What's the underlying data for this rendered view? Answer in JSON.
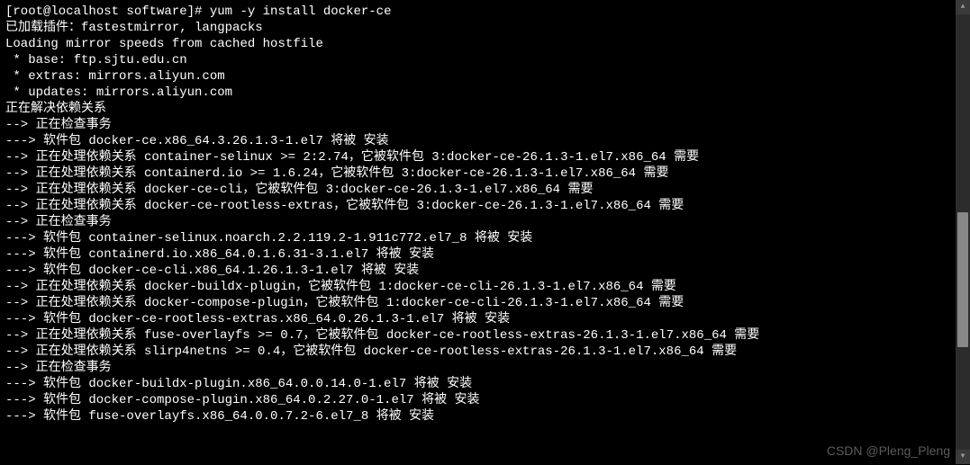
{
  "prompt": "[root@localhost software]# ",
  "command": "yum -y install docker-ce",
  "lines": [
    "已加载插件：fastestmirror, langpacks",
    "Loading mirror speeds from cached hostfile",
    " * base: ftp.sjtu.edu.cn",
    " * extras: mirrors.aliyun.com",
    " * updates: mirrors.aliyun.com",
    "正在解决依赖关系",
    "--> 正在检查事务",
    "---> 软件包 docker-ce.x86_64.3.26.1.3-1.el7 将被 安装",
    "--> 正在处理依赖关系 container-selinux >= 2:2.74，它被软件包 3:docker-ce-26.1.3-1.el7.x86_64 需要",
    "--> 正在处理依赖关系 containerd.io >= 1.6.24，它被软件包 3:docker-ce-26.1.3-1.el7.x86_64 需要",
    "--> 正在处理依赖关系 docker-ce-cli，它被软件包 3:docker-ce-26.1.3-1.el7.x86_64 需要",
    "--> 正在处理依赖关系 docker-ce-rootless-extras，它被软件包 3:docker-ce-26.1.3-1.el7.x86_64 需要",
    "--> 正在检查事务",
    "---> 软件包 container-selinux.noarch.2.2.119.2-1.911c772.el7_8 将被 安装",
    "---> 软件包 containerd.io.x86_64.0.1.6.31-3.1.el7 将被 安装",
    "---> 软件包 docker-ce-cli.x86_64.1.26.1.3-1.el7 将被 安装",
    "--> 正在处理依赖关系 docker-buildx-plugin，它被软件包 1:docker-ce-cli-26.1.3-1.el7.x86_64 需要",
    "--> 正在处理依赖关系 docker-compose-plugin，它被软件包 1:docker-ce-cli-26.1.3-1.el7.x86_64 需要",
    "---> 软件包 docker-ce-rootless-extras.x86_64.0.26.1.3-1.el7 将被 安装",
    "--> 正在处理依赖关系 fuse-overlayfs >= 0.7，它被软件包 docker-ce-rootless-extras-26.1.3-1.el7.x86_64 需要",
    "--> 正在处理依赖关系 slirp4netns >= 0.4，它被软件包 docker-ce-rootless-extras-26.1.3-1.el7.x86_64 需要",
    "--> 正在检查事务",
    "---> 软件包 docker-buildx-plugin.x86_64.0.0.14.0-1.el7 将被 安装",
    "---> 软件包 docker-compose-plugin.x86_64.0.2.27.0-1.el7 将被 安装",
    "---> 软件包 fuse-overlayfs.x86_64.0.0.7.2-6.el7_8 将被 安装"
  ],
  "watermark": "CSDN @Pleng_Pleng"
}
